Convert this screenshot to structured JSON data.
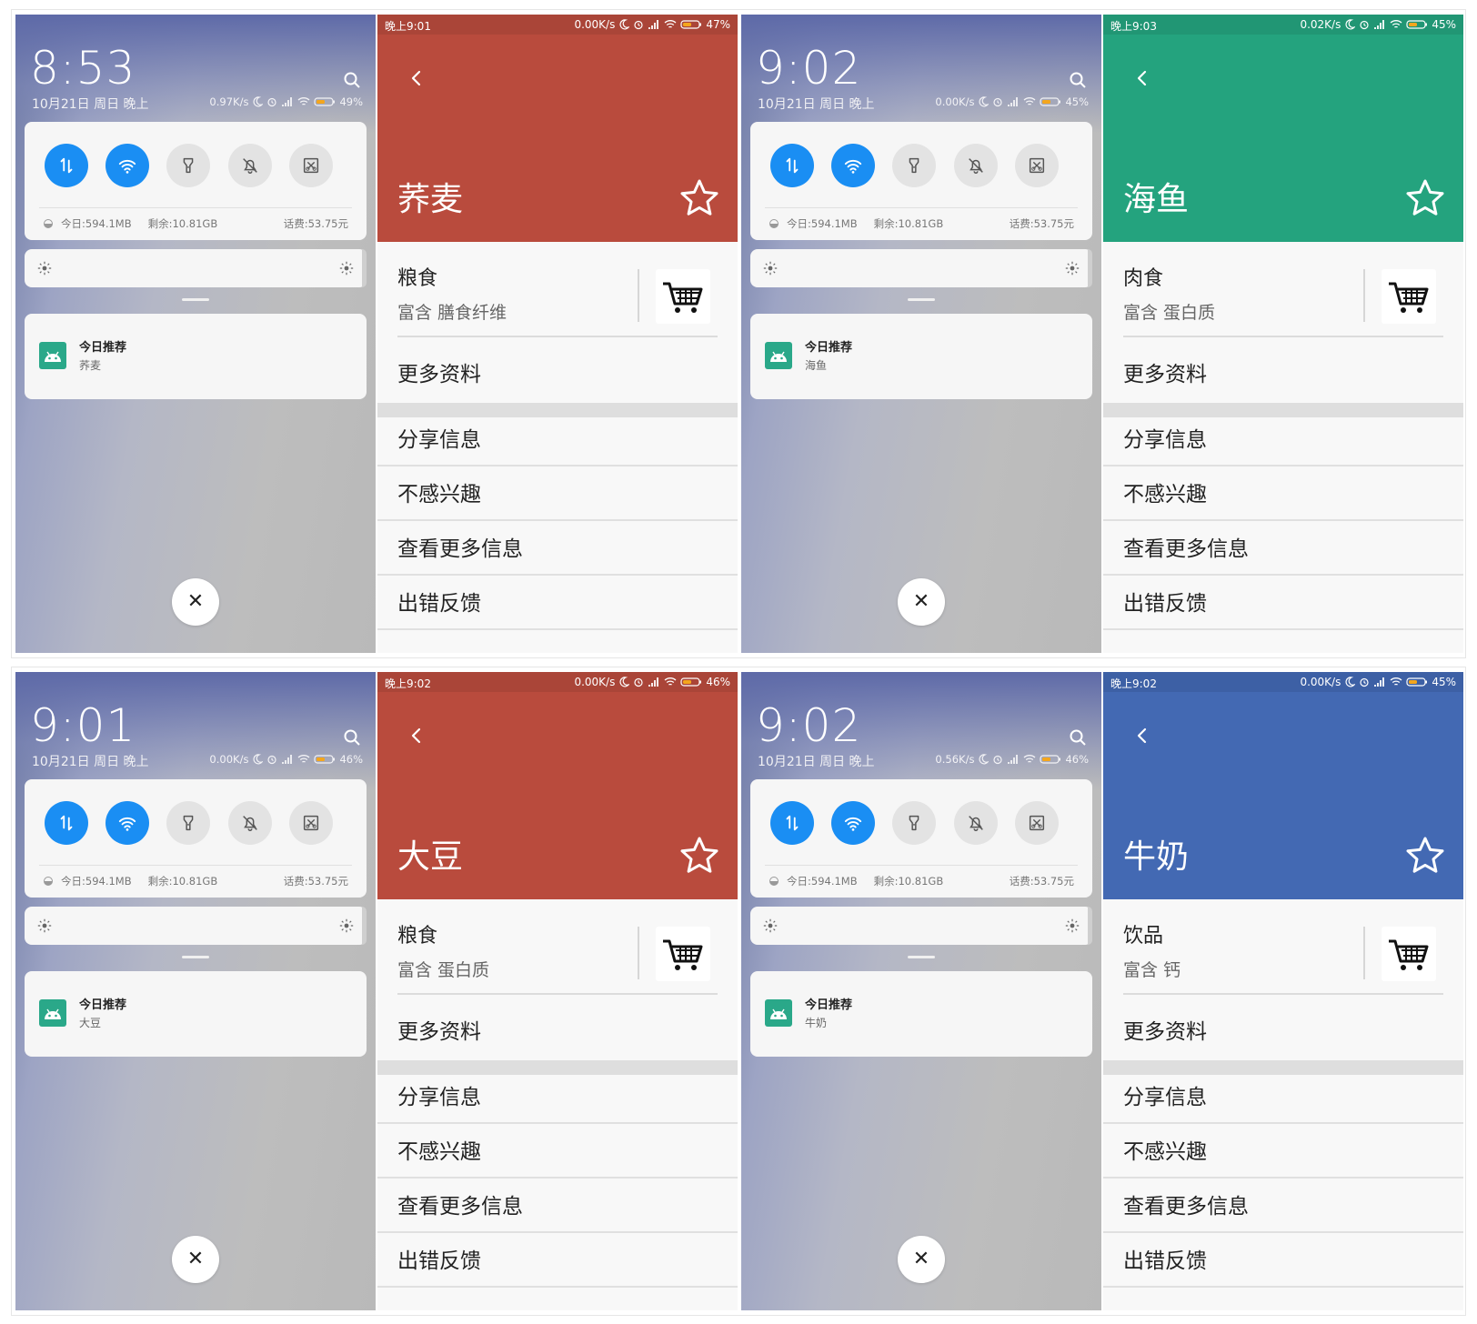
{
  "shade": {
    "date": "10月21日 周日 晚上",
    "data_today": "今日:594.1MB",
    "data_left": "剩余:10.81GB",
    "data_fee": "话费:53.75元",
    "notif_title": "今日推荐"
  },
  "detail": {
    "more_info": "更多资料",
    "share": "分享信息",
    "not_interested": "不感兴趣",
    "view_more": "查看更多信息",
    "feedback": "出错反馈"
  },
  "rows": [
    {
      "shade": {
        "clock": "8:53",
        "speed": "0.97K/s",
        "battery": "49%",
        "notif_body": "荞麦"
      },
      "detail": {
        "time": "晚上9:01",
        "speed": "0.00K/s",
        "battery": "47%",
        "title": "荞麦",
        "color": "#b94b3d",
        "category": "粮食",
        "rich": "富含 膳食纤维"
      }
    },
    {
      "shade": {
        "clock": "9:02",
        "speed": "0.00K/s",
        "battery": "45%",
        "notif_body": "海鱼"
      },
      "detail": {
        "time": "晚上9:03",
        "speed": "0.02K/s",
        "battery": "45%",
        "title": "海鱼",
        "color": "#24a37e",
        "category": "肉食",
        "rich": "富含 蛋白质"
      }
    },
    {
      "shade": {
        "clock": "9:01",
        "speed": "0.00K/s",
        "battery": "46%",
        "notif_body": "大豆"
      },
      "detail": {
        "time": "晚上9:02",
        "speed": "0.00K/s",
        "battery": "46%",
        "title": "大豆",
        "color": "#b94b3d",
        "category": "粮食",
        "rich": "富含 蛋白质"
      }
    },
    {
      "shade": {
        "clock": "9:02",
        "speed": "0.56K/s",
        "battery": "46%",
        "notif_body": "牛奶"
      },
      "detail": {
        "time": "晚上9:02",
        "speed": "0.00K/s",
        "battery": "45%",
        "title": "牛奶",
        "color": "#4369b3",
        "category": "饮品",
        "rich": "富含 钙"
      }
    }
  ]
}
